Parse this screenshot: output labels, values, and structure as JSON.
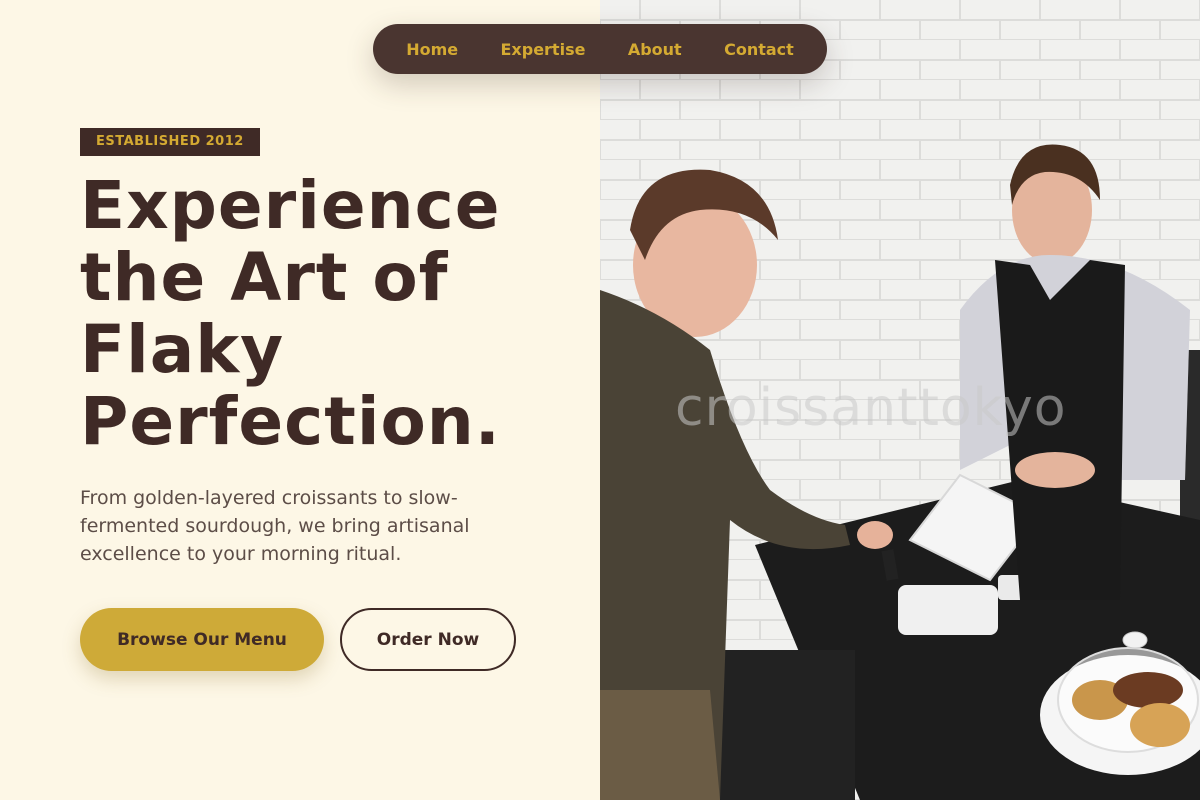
{
  "nav": {
    "items": [
      {
        "label": "Home"
      },
      {
        "label": "Expertise"
      },
      {
        "label": "About"
      },
      {
        "label": "Contact"
      }
    ]
  },
  "hero": {
    "badge": "ESTABLISHED 2012",
    "headline": "Experience the Art of Flaky Perfection.",
    "description": "From golden-layered croissants to slow-fermented sourdough, we bring artisanal excellence to your morning ritual.",
    "primary_button": "Browse Our Menu",
    "secondary_button": "Order Now"
  },
  "photo": {
    "watermark": "croissanttokyo"
  },
  "colors": {
    "background": "#fdf7e6",
    "brown": "#3f2a26",
    "gold": "#ceaa38"
  }
}
